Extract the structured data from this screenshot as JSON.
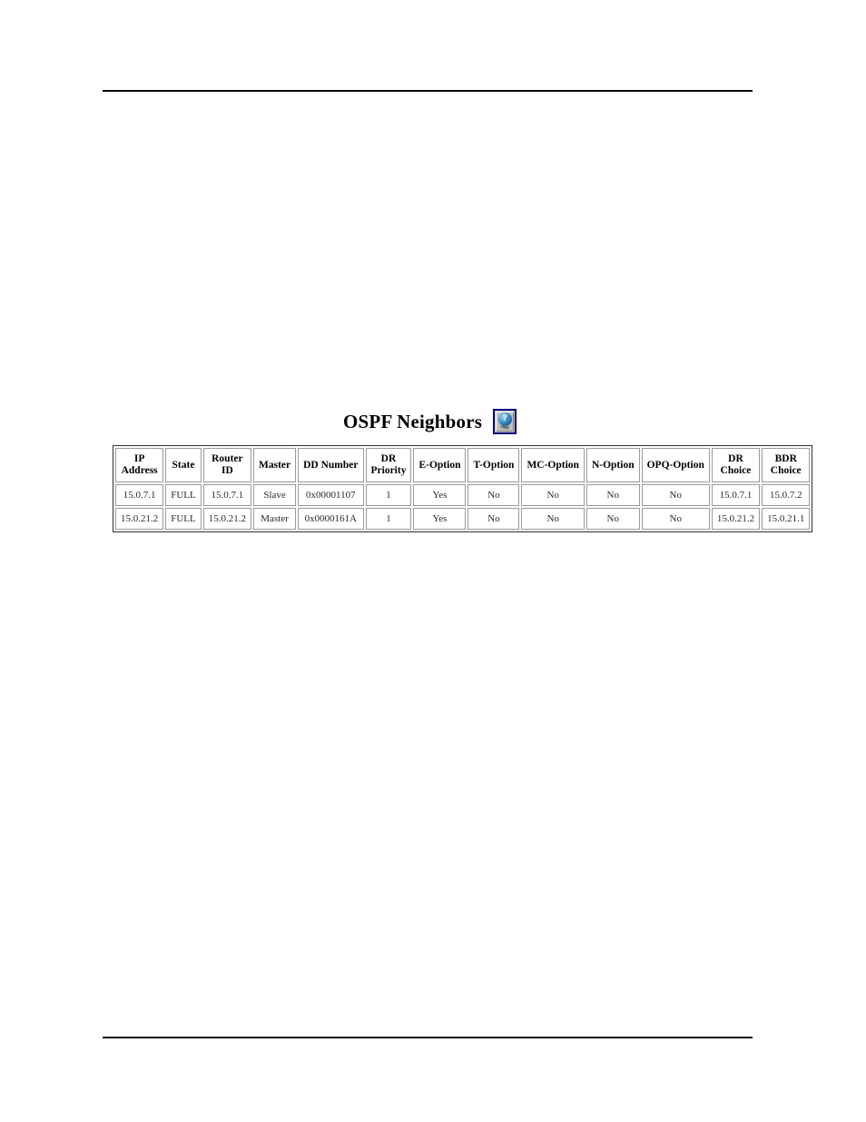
{
  "page": {
    "title": "OSPF Neighbors",
    "help_button": {
      "icon": "help-globe-icon",
      "caption": "Help",
      "symbol": "?",
      "border_color": "#00007F",
      "face_color": "#C0C0C0"
    },
    "rules": {
      "top": "horizontal-rule",
      "bottom": "horizontal-rule"
    }
  },
  "table": {
    "name": "ospf-neighbors-table",
    "columns": [
      {
        "id": "ip-address",
        "line1": "IP",
        "line2": "Address"
      },
      {
        "id": "state",
        "line1": "State",
        "line2": ""
      },
      {
        "id": "router-id",
        "line1": "Router",
        "line2": "ID"
      },
      {
        "id": "master",
        "line1": "Master",
        "line2": ""
      },
      {
        "id": "dd-number",
        "line1": "DD Number",
        "line2": ""
      },
      {
        "id": "dr-priority",
        "line1": "DR",
        "line2": "Priority"
      },
      {
        "id": "e-option",
        "line1": "E-Option",
        "line2": ""
      },
      {
        "id": "t-option",
        "line1": "T-Option",
        "line2": ""
      },
      {
        "id": "mc-option",
        "line1": "MC-Option",
        "line2": ""
      },
      {
        "id": "n-option",
        "line1": "N-Option",
        "line2": ""
      },
      {
        "id": "opq-option",
        "line1": "OPQ-Option",
        "line2": ""
      },
      {
        "id": "dr-choice",
        "line1": "DR",
        "line2": "Choice"
      },
      {
        "id": "bdr-choice",
        "line1": "BDR",
        "line2": "Choice"
      }
    ],
    "rows": [
      {
        "ip_address": "15.0.7.1",
        "state": "FULL",
        "router_id": "15.0.7.1",
        "master": "Slave",
        "dd_number": "0x00001107",
        "dr_priority": "1",
        "e_option": "Yes",
        "t_option": "No",
        "mc_option": "No",
        "n_option": "No",
        "opq_option": "No",
        "dr_choice": "15.0.7.1",
        "bdr_choice": "15.0.7.2"
      },
      {
        "ip_address": "15.0.21.2",
        "state": "FULL",
        "router_id": "15.0.21.2",
        "master": "Master",
        "dd_number": "0x0000161A",
        "dr_priority": "1",
        "e_option": "Yes",
        "t_option": "No",
        "mc_option": "No",
        "n_option": "No",
        "opq_option": "No",
        "dr_choice": "15.0.21.2",
        "bdr_choice": "15.0.21.1"
      }
    ]
  }
}
